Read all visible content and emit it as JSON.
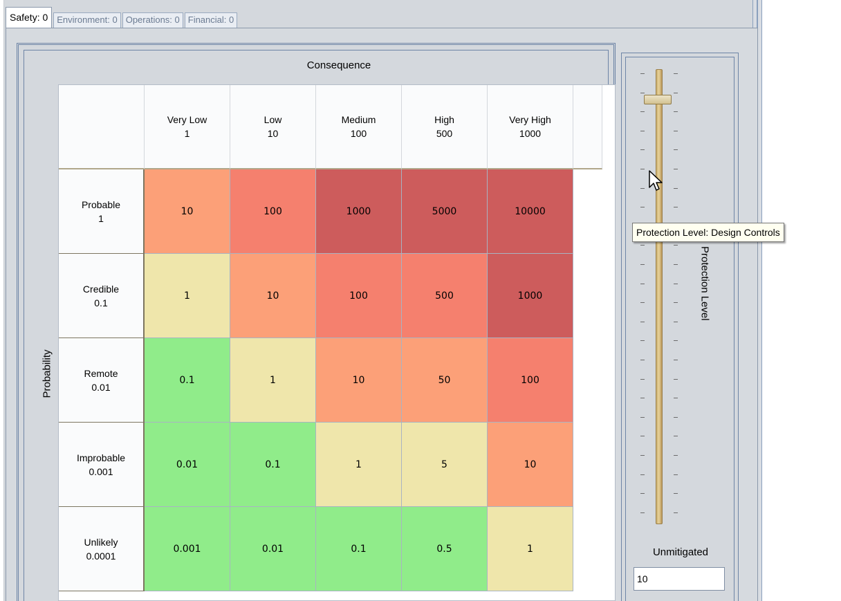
{
  "tabs": [
    {
      "label": "Safety: 0",
      "active": true
    },
    {
      "label": "Environment: 0",
      "active": false
    },
    {
      "label": "Operations: 0",
      "active": false
    },
    {
      "label": "Financial: 0",
      "active": false
    }
  ],
  "matrix": {
    "consequence_title": "Consequence",
    "probability_title": "Probability",
    "columns": [
      {
        "name": "Very Low",
        "value": "1"
      },
      {
        "name": "Low",
        "value": "10"
      },
      {
        "name": "Medium",
        "value": "100"
      },
      {
        "name": "High",
        "value": "500"
      },
      {
        "name": "Very High",
        "value": "1000"
      }
    ],
    "rows": [
      {
        "name": "Probable",
        "value": "1",
        "cells": [
          "10",
          "100",
          "1000",
          "5000",
          "10000"
        ],
        "colors": [
          "#fca078",
          "#f5806e",
          "#cd5c5c",
          "#cd5c5c",
          "#cd5c5c"
        ]
      },
      {
        "name": "Credible",
        "value": "0.1",
        "cells": [
          "1",
          "10",
          "100",
          "500",
          "1000"
        ],
        "colors": [
          "#efe6ab",
          "#fca078",
          "#f5806e",
          "#f5806e",
          "#cd5c5c"
        ]
      },
      {
        "name": "Remote",
        "value": "0.01",
        "cells": [
          "0.1",
          "1",
          "10",
          "50",
          "100"
        ],
        "colors": [
          "#90ec8a",
          "#efe6ab",
          "#fca078",
          "#fca078",
          "#f5806e"
        ]
      },
      {
        "name": "Improbable",
        "value": "0.001",
        "cells": [
          "0.01",
          "0.1",
          "1",
          "5",
          "10"
        ],
        "colors": [
          "#90ec8a",
          "#90ec8a",
          "#efe6ab",
          "#efe6ab",
          "#fca078"
        ]
      },
      {
        "name": "Unlikely",
        "value": "0.0001",
        "cells": [
          "0.001",
          "0.01",
          "0.1",
          "0.5",
          "1"
        ],
        "colors": [
          "#90ec8a",
          "#90ec8a",
          "#90ec8a",
          "#90ec8a",
          "#efe6ab"
        ]
      }
    ]
  },
  "slider": {
    "axis_label": "Protection Level",
    "tooltip": "Protection Level: Design Controls",
    "level_label": "Unmitigated",
    "value": "10"
  },
  "colors": {
    "very_high_risk": "#cd5c5c",
    "high_risk": "#f5806e",
    "medium_risk": "#fca078",
    "low_risk": "#efe6ab",
    "very_low_risk": "#90ec8a"
  }
}
